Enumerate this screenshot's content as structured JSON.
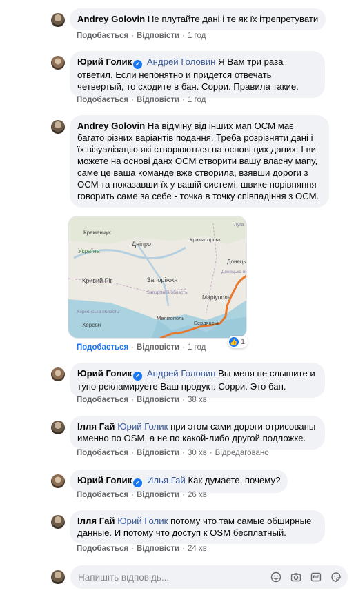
{
  "comments": [
    {
      "author": "Andrey Golovin",
      "text": "Не плутайте дані і те як їх ітрепретувати",
      "like_label": "Подобається",
      "reply_label": "Відповісти",
      "time": "1 год"
    },
    {
      "author": "Юрий Голик",
      "mention": "Андрей Головин",
      "text": "Я Вам три раза ответил. Если непонятно и придется отвечать четвертый, то сходите в бан. Сорри. Правила такие.",
      "like_label": "Подобається",
      "reply_label": "Відповісти",
      "time": "1 год"
    },
    {
      "author": "Andrey Golovin",
      "text": "На відміну від інших мап ОСМ має багато різних варіантів подання. Треба розрізняти дані і їх візуалізацію які створюються на основі цих даних. І ви можете на основі данх ОСМ створити вашу власну мапу, саме це ваша команде вже створила, взявши дороги з ОСМ та показавши їх у вашій системі, швике порівняння говорить саме за себе - точка в точку співпадіння з ОСМ.",
      "like_label": "Подобається",
      "reply_label": "Відповісти",
      "time": "1 год",
      "reaction_count": "1"
    },
    {
      "author": "Юрий Голик",
      "mention": "Андрей Головин",
      "text": "Вы меня не слышите и тупо рекламируете Ваш продукт. Сорри. Это бан.",
      "like_label": "Подобається",
      "reply_label": "Відповісти",
      "time": "38 хв"
    },
    {
      "author": "Ілля Гай",
      "mention": "Юрий Голик",
      "text": "при этом сами дороги отрисованы именно по OSM, а не по какой-либо другой подложке.",
      "like_label": "Подобається",
      "reply_label": "Відповісти",
      "time": "30 хв",
      "edited": "Відредаговано"
    },
    {
      "author": "Юрий Голик",
      "mention": "Илья Гай",
      "text": "Как думаете, почему?",
      "like_label": "Подобається",
      "reply_label": "Відповісти",
      "time": "26 хв"
    },
    {
      "author": "Ілля Гай",
      "mention": "Юрий Голик",
      "text": "потому что там самые обширные данные. И потому что доступ к OSM бесплатный.",
      "like_label": "Подобається",
      "reply_label": "Відповісти",
      "time": "24 хв"
    }
  ],
  "map": {
    "labels": {
      "kremenchuk": "Кременчук",
      "ukraine": "Україна",
      "dnipro": "Дніпро",
      "kramatorsk": "Краматорськ",
      "luhansk": "Луга",
      "donetsk": "Донецьк",
      "donetsk_obl": "Донецька область",
      "kryvyi_rih": "Кривий Ріг",
      "zaporizhzhia": "Запоріжжя",
      "zaporizka_obl": "Запорізька область",
      "mariupol": "Маріуполь",
      "khersonska_obl": "Херсонська область",
      "melitopol": "Мелітополь",
      "berdiansk": "Бердянськ",
      "kherson": "Херсон"
    }
  },
  "reply": {
    "placeholder": "Напишіть відповідь..."
  },
  "colors": {
    "bubble": "#f0f2f5",
    "link": "#385898",
    "meta": "#65676b",
    "verified": "#1877f2",
    "road": "#e8772e"
  }
}
